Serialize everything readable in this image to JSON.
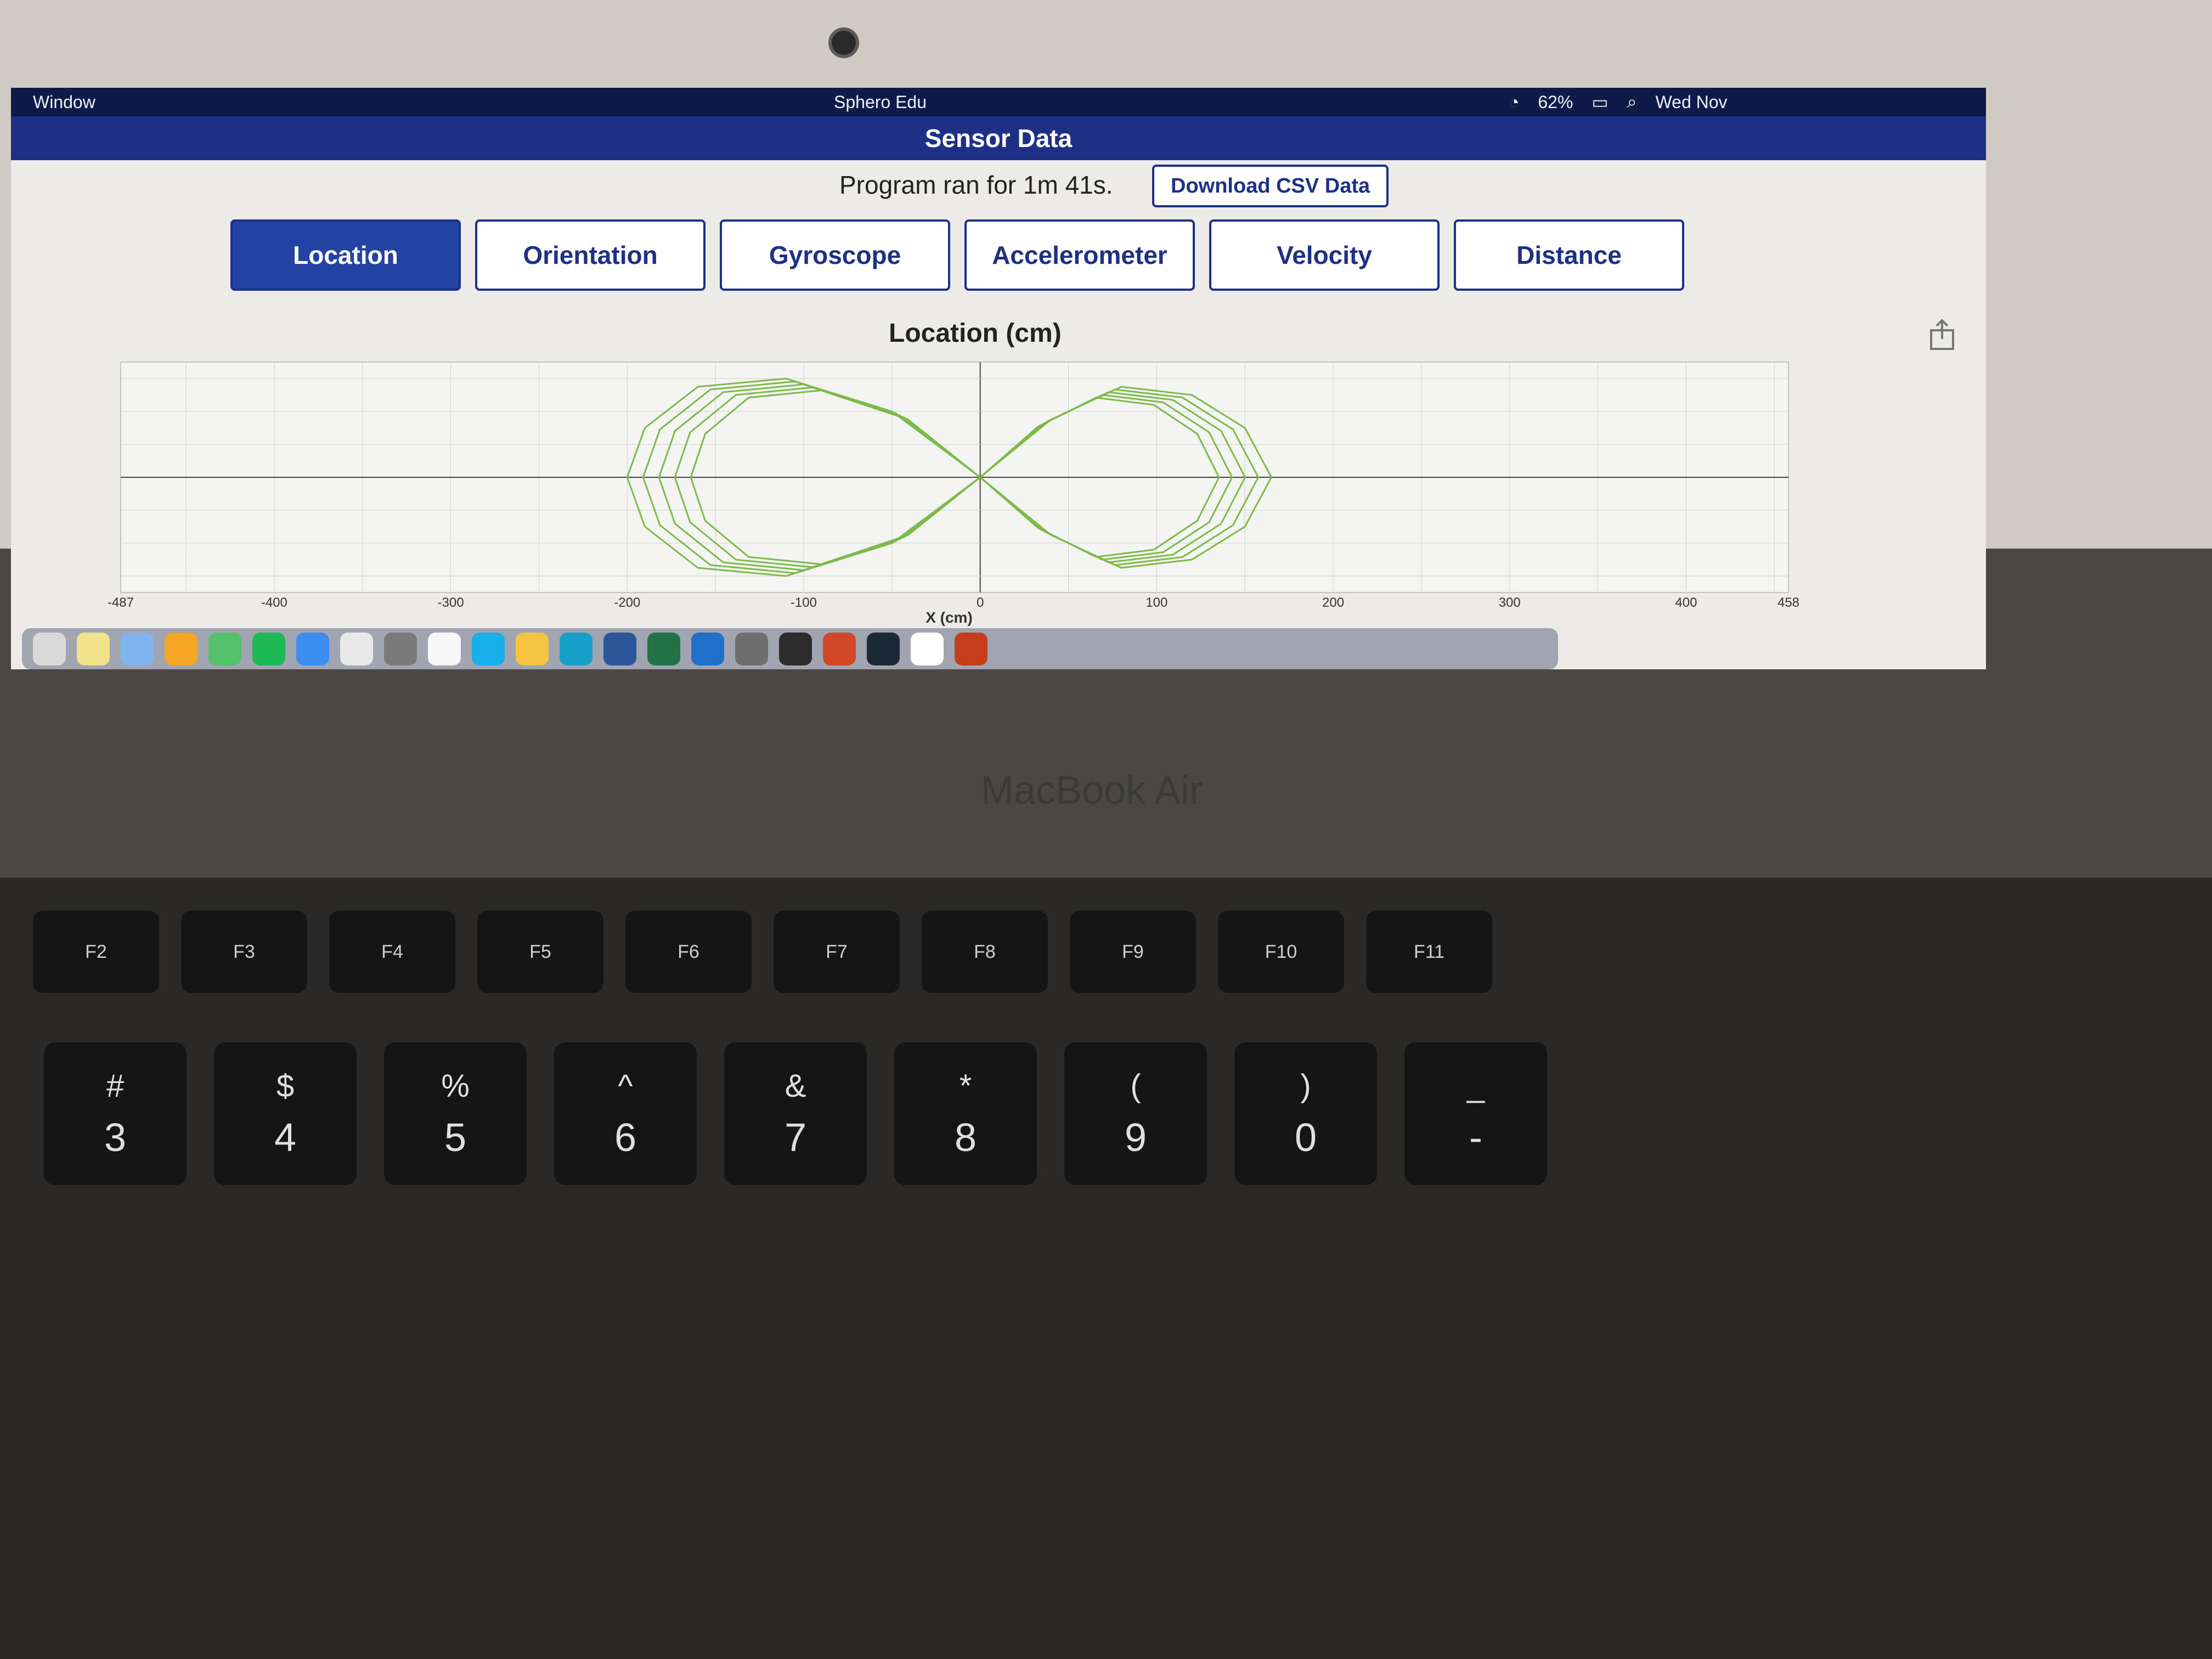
{
  "menubar": {
    "window_menu": "Window",
    "app_title": "Sphero Edu",
    "battery": "62%",
    "clock": "Wed Nov"
  },
  "header": {
    "title": "Sensor Data"
  },
  "run": {
    "label": "Program ran for 1m 41s.",
    "download_label": "Download CSV Data"
  },
  "tabs": [
    {
      "label": "Location",
      "active": true
    },
    {
      "label": "Orientation",
      "active": false
    },
    {
      "label": "Gyroscope",
      "active": false
    },
    {
      "label": "Accelerometer",
      "active": false
    },
    {
      "label": "Velocity",
      "active": false
    },
    {
      "label": "Distance",
      "active": false
    }
  ],
  "chart_data": {
    "type": "line",
    "title": "Location (cm)",
    "xlabel": "X (cm)",
    "ylabel": "",
    "xlim": [
      -487,
      458
    ],
    "x_ticks": [
      "-487",
      "-400",
      "-300",
      "-200",
      "-100",
      "0",
      "100",
      "200",
      "300",
      "400",
      "458"
    ],
    "grid": true,
    "color": "#7cbb4a",
    "series": [
      {
        "name": "",
        "values_note": "",
        "x": [
          0,
          40,
          80,
          120,
          150,
          165,
          150,
          120,
          80,
          40,
          0,
          -50,
          -110,
          -160,
          -190,
          -200,
          -190,
          -160,
          -110,
          -50,
          0
        ],
        "y": [
          0,
          70,
          110,
          100,
          60,
          0,
          -60,
          -100,
          -110,
          -70,
          0,
          80,
          120,
          110,
          60,
          0,
          -60,
          -110,
          -120,
          -80,
          0
        ]
      }
    ]
  },
  "device": {
    "model": "MacBook Air",
    "fkeys": [
      "F2",
      "F3",
      "F4",
      "F5",
      "F6",
      "F7",
      "F8",
      "F9",
      "F10",
      "F11"
    ],
    "numkeys": [
      {
        "top": "#",
        "bottom": "3"
      },
      {
        "top": "$",
        "bottom": "4"
      },
      {
        "top": "%",
        "bottom": "5"
      },
      {
        "top": "^",
        "bottom": "6"
      },
      {
        "top": "&",
        "bottom": "7"
      },
      {
        "top": "*",
        "bottom": "8"
      },
      {
        "top": "(",
        "bottom": "9"
      },
      {
        "top": ")",
        "bottom": "0"
      },
      {
        "top": "_",
        "bottom": "-"
      }
    ]
  }
}
